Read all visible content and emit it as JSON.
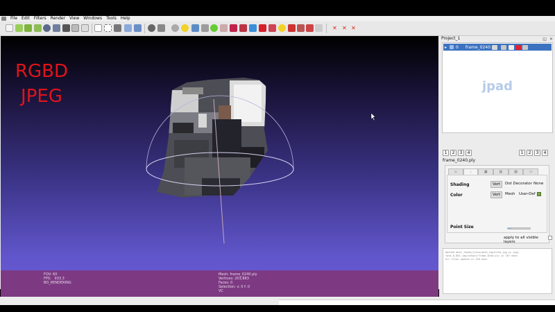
{
  "menubar": {
    "items": [
      "File",
      "Edit",
      "Filters",
      "Render",
      "View",
      "Windows",
      "Tools",
      "Help"
    ]
  },
  "toolbar": {
    "icons": [
      "new-project-icon",
      "open-project-icon",
      "save-project-icon",
      "import-mesh-icon",
      "reload-icon",
      "export-mesh-icon",
      "snapshot-icon",
      "toggle-layer-icon",
      "trackball-icon",
      "fullscreen-icon",
      "unknown-icon",
      "layers-icon",
      "decorator-icon",
      "bbox-icon",
      "points-icon",
      "wire-icon",
      "flat-icon",
      "smooth-icon",
      "texture-icon",
      "annotation-icon",
      "measure-icon",
      "paint-icon",
      "select-icon",
      "select-vertex-icon",
      "edit-icon",
      "color-icon",
      "align-icon",
      "manipulator-icon",
      "info-icon",
      "pick-icon",
      "georef-icon",
      "zoom-icon",
      "remove-icon",
      "remove-vertex-icon",
      "remove-face-icon"
    ]
  },
  "viewport": {
    "overlay_line1": "RGBD",
    "overlay_line2": "JPEG",
    "info_left": "FOV: 60\nFPS:   933.3\nBO_RENDERING",
    "info_right": "Mesh: frame_0240.ply\nVertices: 203,883\nFaces: 0\nSelection: v: 0 f: 0\nVC"
  },
  "panel": {
    "title": "Project_1",
    "layer": {
      "id": "0",
      "name": "frame_0240"
    },
    "watermark": "jpad",
    "num_buttons_left": [
      "1",
      "2",
      "3",
      "4"
    ],
    "num_buttons_right": [
      "1",
      "2",
      "3",
      "4"
    ],
    "file_label": "frame_0240.ply",
    "shading": {
      "label": "Shading",
      "options": [
        "Vert",
        "Dot Decorator",
        "None"
      ],
      "selected": "Vert"
    },
    "color": {
      "label": "Color",
      "options": [
        "Vert",
        "Mesh",
        "User-Def"
      ],
      "selected": "Vert",
      "swatch": "#7aa84b"
    },
    "point_size": {
      "label": "Point Size",
      "value": 0.15
    },
    "apply_label": "apply to all visible layers",
    "log": "Opened mesh /home/jitno/data_captured_jpg_cc.jpg/\ntask_0_001.jpg/output/frame_0240.ply in 167 msec\nAll files opened in 128 msec"
  },
  "colors": {
    "accent": "#3c72c0",
    "overlay_text": "#e0141a",
    "info_bar": "#7d3a82"
  }
}
